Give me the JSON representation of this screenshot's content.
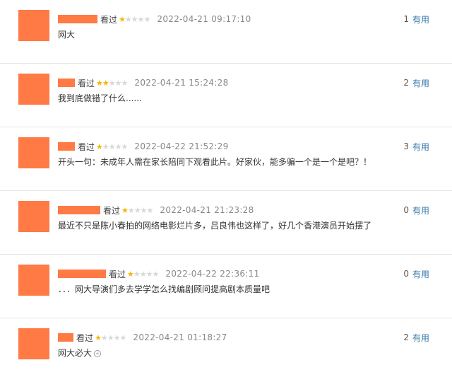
{
  "colors": {
    "accent": "#3377aa",
    "mask": "#ff7a45",
    "star": "#f7b500"
  },
  "reviews": [
    {
      "seen": "看过",
      "rating": 1,
      "time": "2022-04-21 09:17:10",
      "count": "1",
      "useful": "有用",
      "comment": "网大"
    },
    {
      "seen": "看过",
      "rating": 2,
      "time": "2022-04-21 15:24:28",
      "count": "2",
      "useful": "有用",
      "comment": "我到底做错了什么......"
    },
    {
      "seen": "看过",
      "rating": 1,
      "time": "2022-04-22 21:52:29",
      "count": "3",
      "useful": "有用",
      "comment": "开头一句：未成年人需在家长陪同下观看此片。好家伙，能多骗一个是一个是吧？！"
    },
    {
      "seen": "看过",
      "rating": 1,
      "time": "2022-04-21 21:23:28",
      "count": "0",
      "useful": "有用",
      "comment": "最近不只是陈小春拍的网络电影烂片多，吕良伟也这样了，好几个香港演员开始摆了"
    },
    {
      "seen": "看过",
      "rating": 1,
      "time": "2022-04-22 22:36:11",
      "count": "0",
      "useful": "有用",
      "comment": "．．．网大导演们多去学学怎么找编剧顾问提高剧本质量吧"
    },
    {
      "seen": "看过",
      "rating": 1,
      "time": "2022-04-21 01:18:27",
      "count": "2",
      "useful": "有用",
      "comment": "网大必大"
    }
  ]
}
